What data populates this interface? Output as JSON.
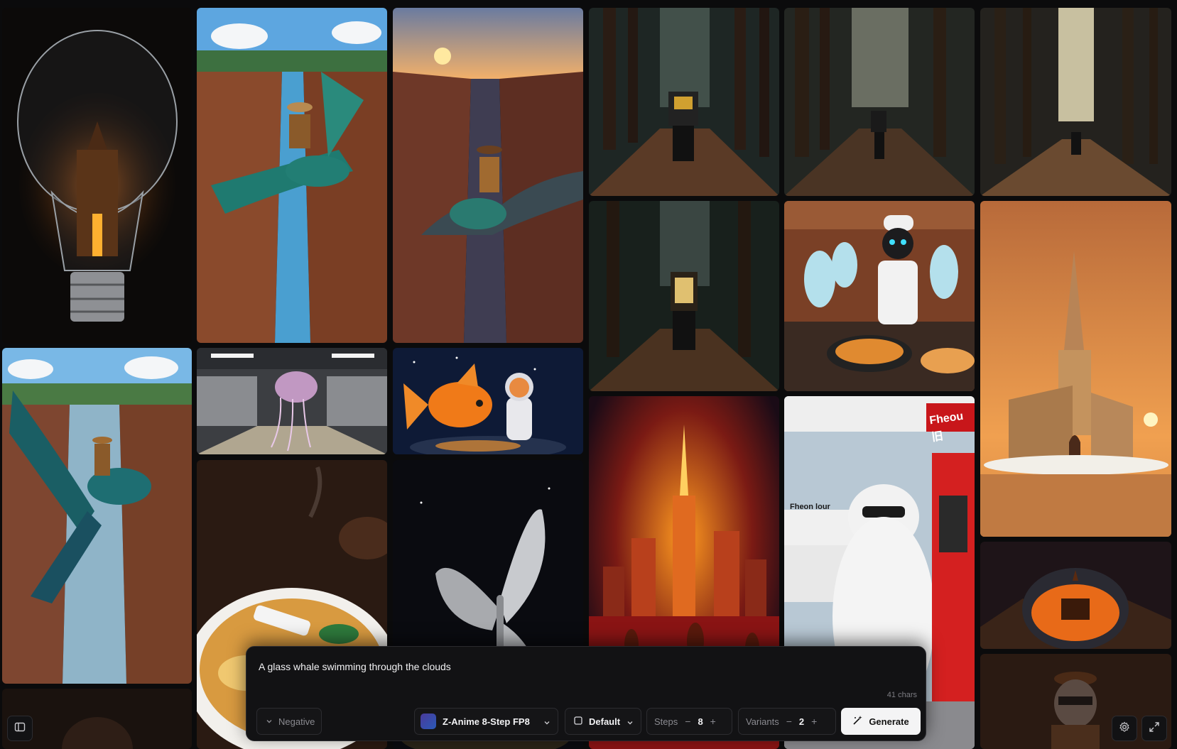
{
  "prompt": {
    "text": "A glass whale swimming through the clouds",
    "char_count": "41 chars"
  },
  "toolbar": {
    "negative_label": "Negative",
    "model_name": "Z-Anime 8-Step FP8",
    "preset_label": "Default",
    "steps_label": "Steps",
    "steps_value": "8",
    "variants_label": "Variants",
    "variants_value": "2",
    "generate_label": "Generate"
  },
  "gallery": {
    "images": [
      {
        "name": "lightbulb-castle"
      },
      {
        "name": "canyon-hummingbird-rider-1"
      },
      {
        "name": "canyon-hummingbird-rider-2"
      },
      {
        "name": "forest-payphone-1"
      },
      {
        "name": "forest-payphone-2"
      },
      {
        "name": "forest-payphone-3"
      },
      {
        "name": "forest-payphone-4"
      },
      {
        "name": "robot-chef-ghosts"
      },
      {
        "name": "desert-sand-church"
      },
      {
        "name": "canyon-hummingbird-rider-3"
      },
      {
        "name": "subway-jellyfish"
      },
      {
        "name": "goldfish-astronaut-cat"
      },
      {
        "name": "ramen-train"
      },
      {
        "name": "chrome-butterfly"
      },
      {
        "name": "violin-city"
      },
      {
        "name": "polar-bear-gas-station"
      },
      {
        "name": "lava-castle-dome"
      },
      {
        "name": "raccoon-portrait"
      }
    ],
    "gas_station_sign_1": "Fheou 旧",
    "gas_station_sign_2": "Fheon lour"
  },
  "colors": {
    "panel_bg": "#121214",
    "generate_bg": "#f4f4f5",
    "page_bg": "#0b0b0c"
  }
}
